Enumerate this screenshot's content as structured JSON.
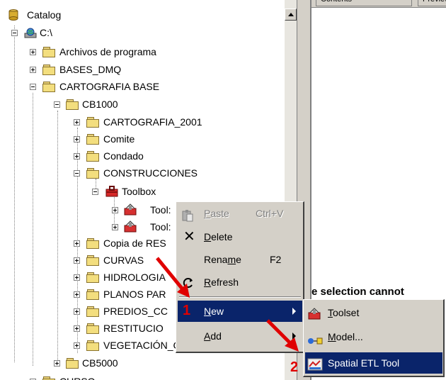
{
  "right_pane": {
    "tabs": [
      "Contents",
      "Preview"
    ],
    "message": "e selection cannot"
  },
  "tree": [
    {
      "label": "Catalog",
      "icon": "catalog-icon",
      "expander": "none"
    },
    {
      "label": "C:\\",
      "icon": "drive-icon",
      "expander": "minus"
    },
    {
      "label": "Archivos de programa",
      "icon": "folder-icon",
      "expander": "plus"
    },
    {
      "label": "BASES_DMQ",
      "icon": "folder-icon",
      "expander": "plus"
    },
    {
      "label": "CARTOGRAFIA BASE",
      "icon": "folder-icon",
      "expander": "minus"
    },
    {
      "label": "CB1000",
      "icon": "folder-icon",
      "expander": "minus"
    },
    {
      "label": "CARTOGRAFIA_2001",
      "icon": "folder-icon",
      "expander": "plus"
    },
    {
      "label": "Comite",
      "icon": "folder-icon",
      "expander": "plus"
    },
    {
      "label": "Condado",
      "icon": "folder-icon",
      "expander": "plus"
    },
    {
      "label": "CONSTRUCCIONES",
      "icon": "folder-icon",
      "expander": "minus"
    },
    {
      "label": "Toolbox",
      "icon": "toolbox-icon",
      "expander": "minus"
    },
    {
      "label": "Tool:",
      "icon": "toolset-icon",
      "expander": "plus"
    },
    {
      "label": "Tool:",
      "icon": "toolset-icon",
      "expander": "plus"
    },
    {
      "label": "Copia de RES",
      "icon": "folder-icon",
      "expander": "plus"
    },
    {
      "label": "CURVAS",
      "icon": "folder-icon",
      "expander": "plus"
    },
    {
      "label": "HIDROLOGIA",
      "icon": "folder-icon",
      "expander": "plus"
    },
    {
      "label": "PLANOS PAR",
      "icon": "folder-icon",
      "expander": "plus"
    },
    {
      "label": "PREDIOS_CC",
      "icon": "folder-icon",
      "expander": "plus"
    },
    {
      "label": "RESTITUCIO",
      "icon": "folder-icon",
      "expander": "plus"
    },
    {
      "label": "VEGETACIÓN_CORANT",
      "icon": "folder-icon",
      "expander": "plus"
    },
    {
      "label": "CB5000",
      "icon": "folder-icon",
      "expander": "plus"
    },
    {
      "label": "CURSO",
      "icon": "folder-icon",
      "expander": "plus"
    }
  ],
  "context_menu": {
    "paste": {
      "pre": "",
      "u": "P",
      "post": "aste",
      "shortcut": "Ctrl+V",
      "icon": "paste-icon"
    },
    "delete": {
      "pre": "",
      "u": "D",
      "post": "elete",
      "icon": "delete-icon"
    },
    "rename": {
      "pre": "Rena",
      "u": "m",
      "post": "e",
      "shortcut": "F2"
    },
    "refresh": {
      "pre": "",
      "u": "R",
      "post": "efresh",
      "icon": "refresh-icon"
    },
    "new": {
      "pre": "",
      "u": "N",
      "post": "ew"
    },
    "add": {
      "pre": "",
      "u": "A",
      "post": "dd"
    }
  },
  "submenu": {
    "toolset": {
      "pre": "",
      "u": "T",
      "post": "oolset",
      "icon": "toolset-icon"
    },
    "model": {
      "pre": "",
      "u": "M",
      "post": "odel...",
      "icon": "model-icon"
    },
    "spatial_etl": {
      "label": "Spatial ETL Tool",
      "icon": "spatial-etl-icon"
    }
  },
  "annotations": {
    "step1": "1",
    "step2": "2"
  },
  "colors": {
    "highlight": "#0a246a",
    "annotation": "#e00000",
    "folder": "#f3de7e"
  }
}
